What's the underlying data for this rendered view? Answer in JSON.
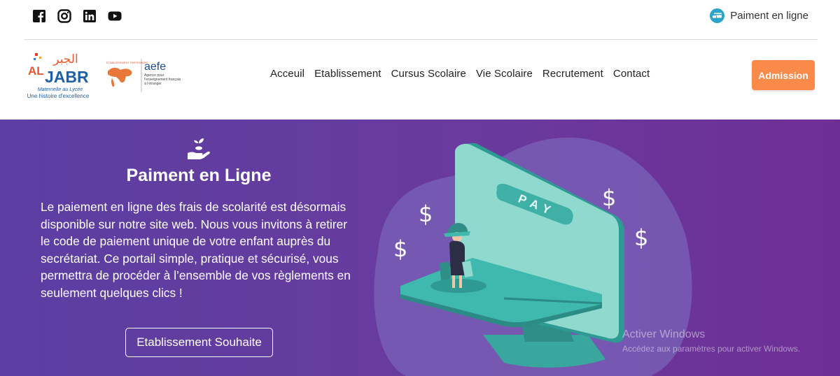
{
  "topbar": {
    "social": [
      {
        "name": "facebook-icon"
      },
      {
        "name": "instagram-icon"
      },
      {
        "name": "linkedin-icon"
      },
      {
        "name": "youtube-icon"
      }
    ],
    "pay_link_label": "Paiment en ligne",
    "pay_link_icon": "payment-icon"
  },
  "header": {
    "logo_main": {
      "arabic": "الجبر",
      "latin": "JABR",
      "prefix": "AL",
      "tagline1": "Maternelle au Lycée",
      "tagline2": "Une histoire d'excellence"
    },
    "logo_aefe": {
      "name": "aefe",
      "badge": "ÉTABLISSEMENT PARTENAIRE",
      "line1": "Agence pour",
      "line2": "l'enseignement français",
      "line3": "à l'étranger"
    },
    "nav": [
      "Acceuil",
      "Etablissement",
      "Cursus Scolaire",
      "Vie Scolaire",
      "Recrutement",
      "Contact"
    ],
    "admission_label": "Admission"
  },
  "hero": {
    "title": "Paiment en Ligne",
    "text": "Le paiement en ligne des frais de scolarité est désormais disponible sur notre site web. Nous vous invitons à retirer le code de paiement unique de votre enfant auprès du secrétariat. Ce portail simple, pratique et sécurisé, vous permettra de procéder à l’ensemble de vos règlements en seulement quelques clics !",
    "button_label": "Etablissement Souhaite",
    "illustration": {
      "pay_label": "PAY",
      "dollar": "$"
    }
  },
  "watermark": {
    "title": "Activer Windows",
    "subtitle": "Accédez aux paramètres pour activer Windows."
  },
  "colors": {
    "accent": "#f98a4a",
    "hero_bg": "#64389d",
    "teal": "#3fb8ae"
  }
}
